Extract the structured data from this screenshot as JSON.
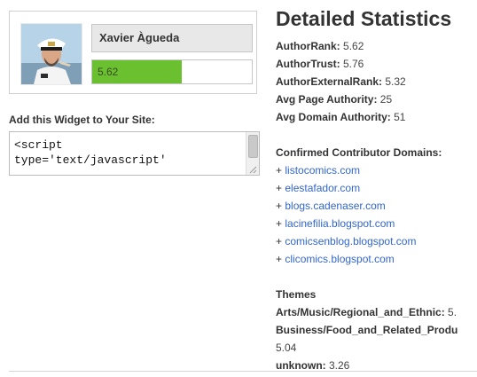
{
  "profile": {
    "name": "Xavier Àgueda",
    "author_rank": "5.62",
    "author_rank_fraction": 0.562
  },
  "widget": {
    "title": "Add this Widget to Your Site:",
    "code_lines": [
      "<script",
      "type='text/javascript'"
    ]
  },
  "stats": {
    "title": "Detailed Statistics",
    "rows": [
      {
        "label": "AuthorRank:",
        "value": "5.62"
      },
      {
        "label": "AuthorTrust:",
        "value": "5.76"
      },
      {
        "label": "AuthorExternalRank:",
        "value": "5.32"
      },
      {
        "label": "Avg Page Authority:",
        "value": "25"
      },
      {
        "label": "Avg Domain Authority:",
        "value": "51"
      }
    ]
  },
  "domains": {
    "title": "Confirmed Contributor Domains:",
    "bullet": "+",
    "items": [
      "listocomics.com",
      "elestafador.com",
      "blogs.cadenaser.com",
      "lacinefilia.blogspot.com",
      "comicsenblog.blogspot.com",
      "clicomics.blogspot.com"
    ]
  },
  "themes": {
    "title": "Themes",
    "items": [
      {
        "label": "Arts/Music/Regional_and_Ethnic:",
        "value": "5."
      },
      {
        "label": "Business/Food_and_Related_Produ",
        "value": ""
      },
      {
        "label": "",
        "value": "5.04"
      },
      {
        "label": "unknown:",
        "value": "3.26"
      }
    ]
  },
  "colors": {
    "rank_bar": "#6bc030",
    "link": "#3366cc"
  }
}
